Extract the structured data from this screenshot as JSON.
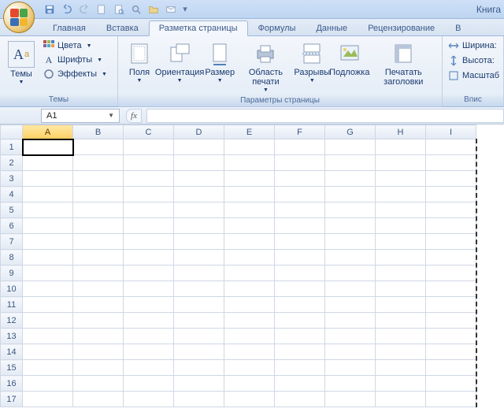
{
  "title": "Книга",
  "qat_icons": [
    "save-icon",
    "undo-icon",
    "redo-icon",
    "new-icon",
    "print-preview-icon",
    "zoom-icon",
    "open-icon",
    "mail-icon"
  ],
  "tabs": [
    {
      "label": "Главная"
    },
    {
      "label": "Вставка"
    },
    {
      "label": "Разметка страницы",
      "active": true
    },
    {
      "label": "Формулы"
    },
    {
      "label": "Данные"
    },
    {
      "label": "Рецензирование"
    },
    {
      "label": "В"
    }
  ],
  "ribbon": {
    "themes": {
      "label": "Темы",
      "big": "Темы",
      "colors": "Цвета",
      "fonts": "Шрифты",
      "effects": "Эффекты"
    },
    "page_setup": {
      "label": "Параметры страницы",
      "margins": "Поля",
      "orientation": "Ориентация",
      "size": "Размер",
      "print_area": "Область печати",
      "breaks": "Разрывы",
      "background": "Подложка",
      "print_titles": "Печатать заголовки"
    },
    "scale": {
      "width": "Ширина:",
      "height": "Высота:",
      "scale": "Масштаб",
      "label": "Впис"
    }
  },
  "namebox": "A1",
  "columns": [
    "A",
    "B",
    "C",
    "D",
    "E",
    "F",
    "G",
    "H",
    "I"
  ],
  "rows": [
    "1",
    "2",
    "3",
    "4",
    "5",
    "6",
    "7",
    "8",
    "9",
    "10",
    "11",
    "12",
    "13",
    "14",
    "15",
    "16",
    "17"
  ],
  "active_cell": {
    "row": 0,
    "col": 0
  }
}
